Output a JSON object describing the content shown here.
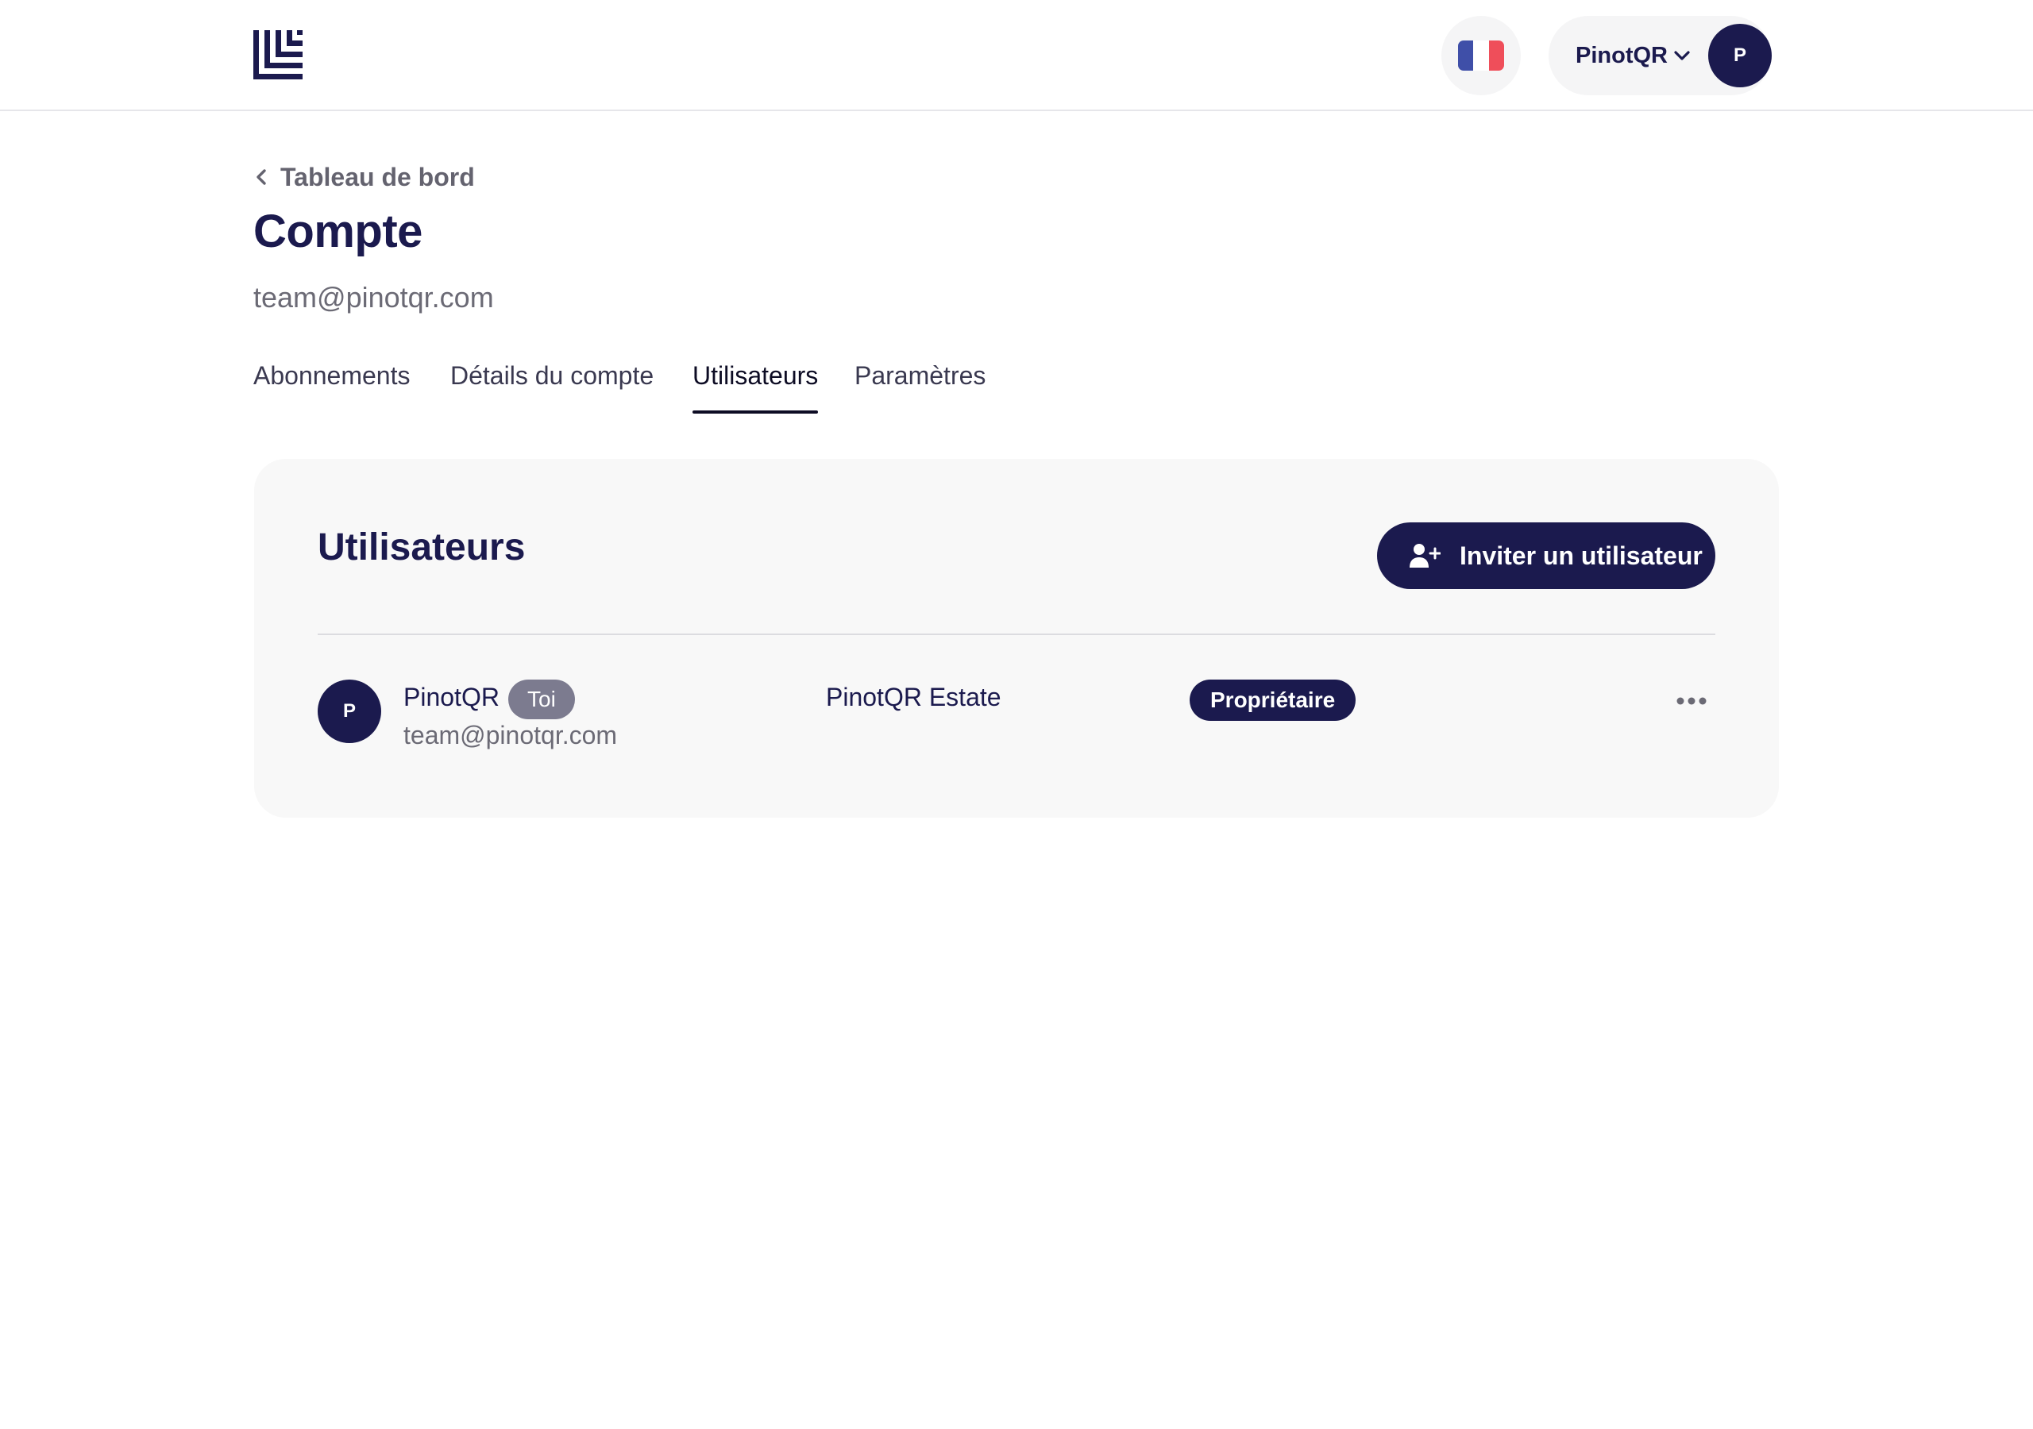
{
  "header": {
    "logo_icon": "brand-logo-icon",
    "language_icon": "france-flag-icon",
    "flag_colors": [
      "#3f4fa8",
      "#ffffff",
      "#ef4e5a"
    ],
    "account_name": "PinotQR",
    "account_avatar_initial": "P",
    "chevron_icon": "chevron-down-icon"
  },
  "breadcrumb": {
    "back_icon": "chevron-left-icon",
    "label": "Tableau de bord"
  },
  "page": {
    "title": "Compte",
    "subtitle": "team@pinotqr.com"
  },
  "tabs": [
    {
      "label": "Abonnements",
      "active": false
    },
    {
      "label": "Détails du compte",
      "active": false
    },
    {
      "label": "Utilisateurs",
      "active": true
    },
    {
      "label": "Paramètres",
      "active": false
    }
  ],
  "users_card": {
    "title": "Utilisateurs",
    "invite_icon": "user-plus-icon",
    "invite_label": "Inviter un utilisateur",
    "rows": [
      {
        "avatar_initial": "P",
        "name": "PinotQR",
        "you_badge": "Toi",
        "email": "team@pinotqr.com",
        "organization": "PinotQR Estate",
        "role": "Propriétaire",
        "menu_icon": "more-horizontal-icon"
      }
    ]
  },
  "colors": {
    "primary": "#1b1a4e",
    "card_background": "#f8f8f8",
    "muted_text": "#6b6a75",
    "you_badge": "#7c7b8f"
  }
}
